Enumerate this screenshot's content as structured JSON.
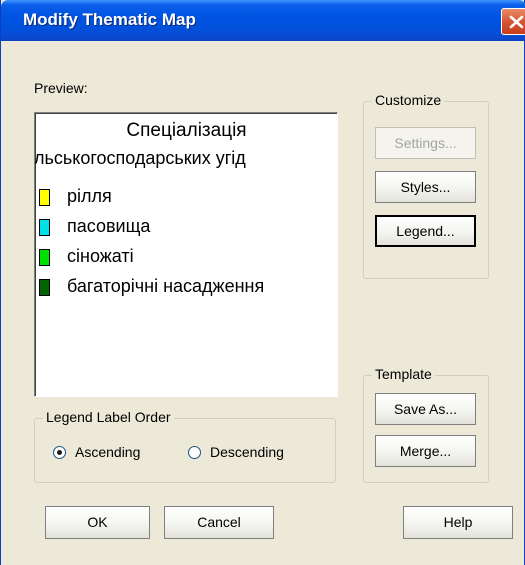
{
  "window": {
    "title": "Modify Thematic Map"
  },
  "preview": {
    "label": "Preview:",
    "legend_title": "Спеціалізація",
    "legend_subtitle": "льськогосподарських угід",
    "items": [
      {
        "label": "рілля",
        "color": "#ffff00"
      },
      {
        "label": "пасовища",
        "color": "#00e0e8"
      },
      {
        "label": "сіножаті",
        "color": "#00e000"
      },
      {
        "label": "багаторічні насадження",
        "color": "#006400"
      }
    ]
  },
  "customize": {
    "group_label": "Customize",
    "settings_label": "Settings...",
    "styles_label": "Styles...",
    "legend_label": "Legend..."
  },
  "template": {
    "group_label": "Template",
    "save_as_label": "Save As...",
    "merge_label": "Merge..."
  },
  "order": {
    "group_label": "Legend Label Order",
    "ascending_label": "Ascending",
    "descending_label": "Descending",
    "selected": "Ascending"
  },
  "footer": {
    "ok_label": "OK",
    "cancel_label": "Cancel",
    "help_label": "Help"
  }
}
